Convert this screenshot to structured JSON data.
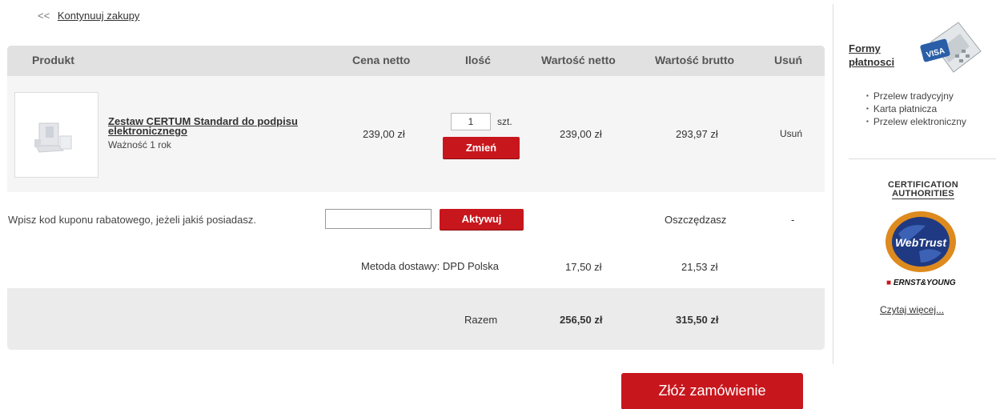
{
  "nav": {
    "back_arrows": "<<",
    "continue_label": "Kontynuuj zakupy"
  },
  "table": {
    "headers": [
      "Produkt",
      "Cena netto",
      "Ilość",
      "Wartość netto",
      "Wartość brutto",
      "Usuń"
    ]
  },
  "item": {
    "name": "Zestaw CERTUM Standard do podpisu elektronicznego",
    "validity": "Ważność 1 rok",
    "price_net": "239,00 zł",
    "quantity": "1",
    "unit": "szt.",
    "change_label": "Zmień",
    "value_net": "239,00 zł",
    "value_gross": "293,97 zł",
    "remove_label": "Usuń"
  },
  "coupon": {
    "prompt": "Wpisz kod kuponu rabatowego, jeżeli jakiś posiadasz.",
    "value": "",
    "activate_label": "Aktywuj",
    "savings_label": "Oszczędzasz",
    "savings_value": "-"
  },
  "shipping": {
    "label": "Metoda dostawy: DPD Polska",
    "net": "17,50 zł",
    "gross": "21,53 zł"
  },
  "total": {
    "label": "Razem",
    "net": "256,50 zł",
    "gross": "315,50 zł"
  },
  "order_button": "Złóż zamówienie",
  "sidebar": {
    "payment_title": "Formy płatnosci",
    "payment_methods": [
      "Przelew tradycyjny",
      "Karta płatnicza",
      "Przelew elektroniczny"
    ],
    "cert_title_line1": "CERTIFICATION",
    "cert_title_line2": "AUTHORITIES",
    "webtrust_logo": "WebTrust",
    "ey_logo": "ERNST & YOUNG",
    "read_more": "Czytaj więcej..."
  },
  "colors": {
    "accent": "#c8161d",
    "header_bg": "#e1e1e1"
  }
}
